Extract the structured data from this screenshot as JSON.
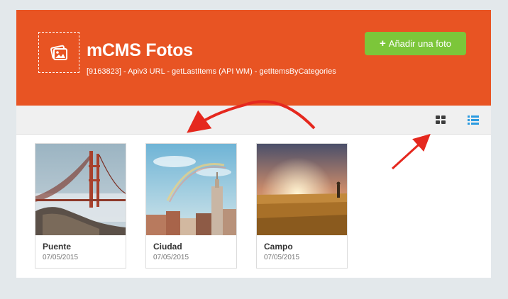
{
  "header": {
    "title": "mCMS Fotos",
    "subtitle": "[9163823] - Apiv3 URL - getLastItems (API WM) - getItemsByCategories",
    "add_button": {
      "icon": "+",
      "label": "Añadir una foto"
    }
  },
  "toolbar": {
    "view_grid_icon": "grid-view-icon",
    "view_list_icon": "list-view-icon"
  },
  "photos": [
    {
      "name": "Puente",
      "date": "07/05/2015"
    },
    {
      "name": "Ciudad",
      "date": "07/05/2015"
    },
    {
      "name": "Campo",
      "date": "07/05/2015"
    }
  ],
  "colors": {
    "header_bg": "#e85423",
    "add_button_bg": "#7cc63a",
    "list_icon": "#2c9be0",
    "annotation_arrow": "#e5281e"
  }
}
